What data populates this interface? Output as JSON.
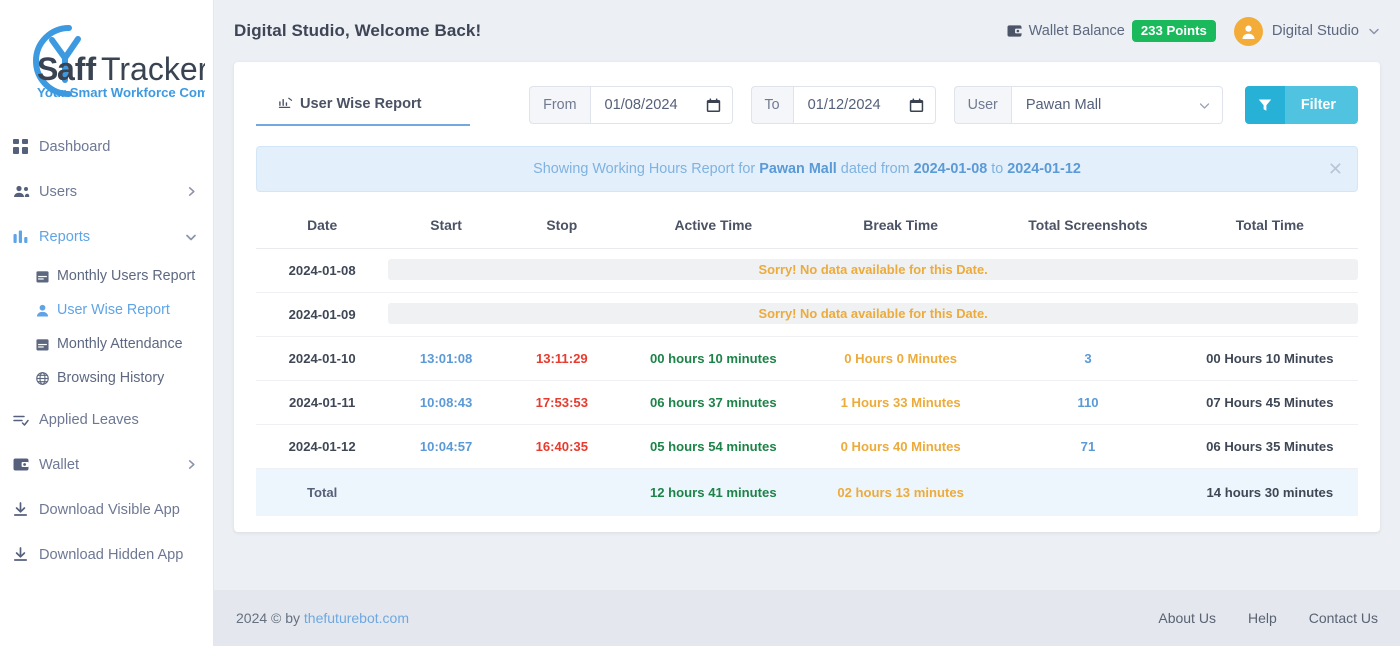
{
  "brand": {
    "name_part1": "S",
    "name_part2": "aff",
    "name_part3": "Tracker",
    "tagline": "Your Smart Workforce Companion"
  },
  "sidebar": {
    "items": [
      {
        "label": "Dashboard",
        "icon": "grid-icon",
        "caret": "",
        "active": false
      },
      {
        "label": "Users",
        "icon": "users-icon",
        "caret": "chevron-right-icon",
        "active": false
      },
      {
        "label": "Reports",
        "icon": "bar-chart-icon",
        "caret": "chevron-down-icon",
        "active": true
      },
      {
        "label": "Applied Leaves",
        "icon": "list-check-icon",
        "caret": "",
        "active": false
      },
      {
        "label": "Wallet",
        "icon": "wallet-icon",
        "caret": "chevron-right-icon",
        "active": false
      },
      {
        "label": "Download Visible App",
        "icon": "download-icon",
        "caret": "",
        "active": false
      },
      {
        "label": "Download Hidden App",
        "icon": "download-icon",
        "caret": "",
        "active": false
      }
    ],
    "reports_submenu": [
      {
        "label": "Monthly Users Report",
        "icon": "calendar-icon",
        "active": false
      },
      {
        "label": "User Wise Report",
        "icon": "person-icon",
        "active": true
      },
      {
        "label": "Monthly Attendance",
        "icon": "calendar-icon",
        "active": false
      },
      {
        "label": "Browsing History",
        "icon": "globe-icon",
        "active": false
      }
    ]
  },
  "header": {
    "welcome": "Digital Studio, Welcome Back!",
    "wallet_label": "Wallet Balance",
    "wallet_points": "233 Points",
    "user_name": "Digital Studio"
  },
  "filters": {
    "tab_label": "User Wise Report",
    "from_label": "From",
    "from_value": "01/08/2024",
    "to_label": "To",
    "to_value": "01/12/2024",
    "user_label": "User",
    "user_value": "Pawan Mall",
    "filter_button": "Filter"
  },
  "alert": {
    "prefix": "Showing Working Hours Report for ",
    "user": "Pawan Mall",
    "middle": " dated from ",
    "date_from": "2024-01-08",
    "joiner": " to ",
    "date_to": "2024-01-12"
  },
  "table": {
    "headers": [
      "Date",
      "Start",
      "Stop",
      "Active Time",
      "Break Time",
      "Total Screenshots",
      "Total Time"
    ],
    "no_data_text": "Sorry! No data available for this Date.",
    "rows": [
      {
        "date": "2024-01-08",
        "empty": true
      },
      {
        "date": "2024-01-09",
        "empty": true
      },
      {
        "date": "2024-01-10",
        "empty": false,
        "start": "13:01:08",
        "stop": "13:11:29",
        "active": "00 hours 10 minutes",
        "break": "0 Hours 0 Minutes",
        "screenshots": "3",
        "total": "00 Hours 10 Minutes"
      },
      {
        "date": "2024-01-11",
        "empty": false,
        "start": "10:08:43",
        "stop": "17:53:53",
        "active": "06 hours 37 minutes",
        "break": "1 Hours 33 Minutes",
        "screenshots": "110",
        "total": "07 Hours 45 Minutes"
      },
      {
        "date": "2024-01-12",
        "empty": false,
        "start": "10:04:57",
        "stop": "16:40:35",
        "active": "05 hours 54 minutes",
        "break": "0 Hours 40 Minutes",
        "screenshots": "71",
        "total": "06 Hours 35 Minutes"
      }
    ],
    "total_row": {
      "label": "Total",
      "active": "12 hours 41 minutes",
      "break": "02 hours 13 minutes",
      "total": "14 hours 30 minutes"
    }
  },
  "footer": {
    "copyright": "2024 © by ",
    "site": "thefuturebot.com",
    "links": [
      "About Us",
      "Help",
      "Contact Us"
    ]
  },
  "colors": {
    "accent_blue": "#5b9ad6",
    "filter_button": "#4fc3e0",
    "badge_green": "#19b95c",
    "active_green": "#1d8348",
    "break_orange": "#ecab3b",
    "stop_red": "#e63b2e",
    "avatar_orange": "#f4ac38"
  }
}
